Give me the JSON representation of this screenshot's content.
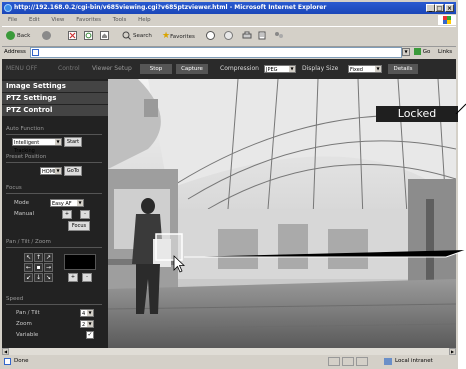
{
  "window": {
    "title": "http://192.168.0.2/cgi-bin/v685viewing.cgi?v685ptzviewer.html - Microsoft Internet Explorer",
    "minimize": "_",
    "maximize": "□",
    "close": "×"
  },
  "menubar": {
    "items": [
      "File",
      "Edit",
      "View",
      "Favorites",
      "Tools",
      "Help"
    ]
  },
  "toolbar": {
    "back": "Back",
    "search": "Search",
    "favorites": "Favorites"
  },
  "addressbar": {
    "label": "Address",
    "go": "Go",
    "links": "Links"
  },
  "viewer": {
    "menu_off": "MENU  OFF",
    "tab_control": "Control",
    "tab_viewer_setup": "Viewer Setup",
    "stop": "Stop",
    "capture": "Capture",
    "compression_label": "Compression",
    "compression_value": "JPEG",
    "display_size_label": "Display Size",
    "display_size_value": "Fixed",
    "details": "Details"
  },
  "panel": {
    "image_settings": "Image Settings",
    "ptz_settings": "PTZ Settings",
    "ptz_control": "PTZ Control",
    "auto_function": {
      "label": "Auto Function",
      "value": "Intelligent Tracking",
      "start": "Start"
    },
    "preset_position": {
      "label": "Preset Position",
      "value": "HOME",
      "goto": "GoTo"
    },
    "focus": {
      "label": "Focus",
      "mode_label": "Mode",
      "mode_value": "Easy AF",
      "manual_label": "Manual",
      "plus": "+",
      "minus": "-",
      "focus_button": "Focus"
    },
    "pan_tilt_zoom": {
      "label": "Pan / Tilt / Zoom",
      "zoom_plus": "+",
      "zoom_minus": "-"
    },
    "speed": {
      "label": "Speed",
      "pan_tilt_label": "Pan / Tilt",
      "pan_tilt_value": "4",
      "zoom_label": "Zoom",
      "zoom_value": "2",
      "variable_label": "Variable",
      "variable_checked": true
    }
  },
  "callout": {
    "locked": "Locked"
  },
  "statusbar": {
    "done": "Done",
    "zone": "Local intranet"
  }
}
